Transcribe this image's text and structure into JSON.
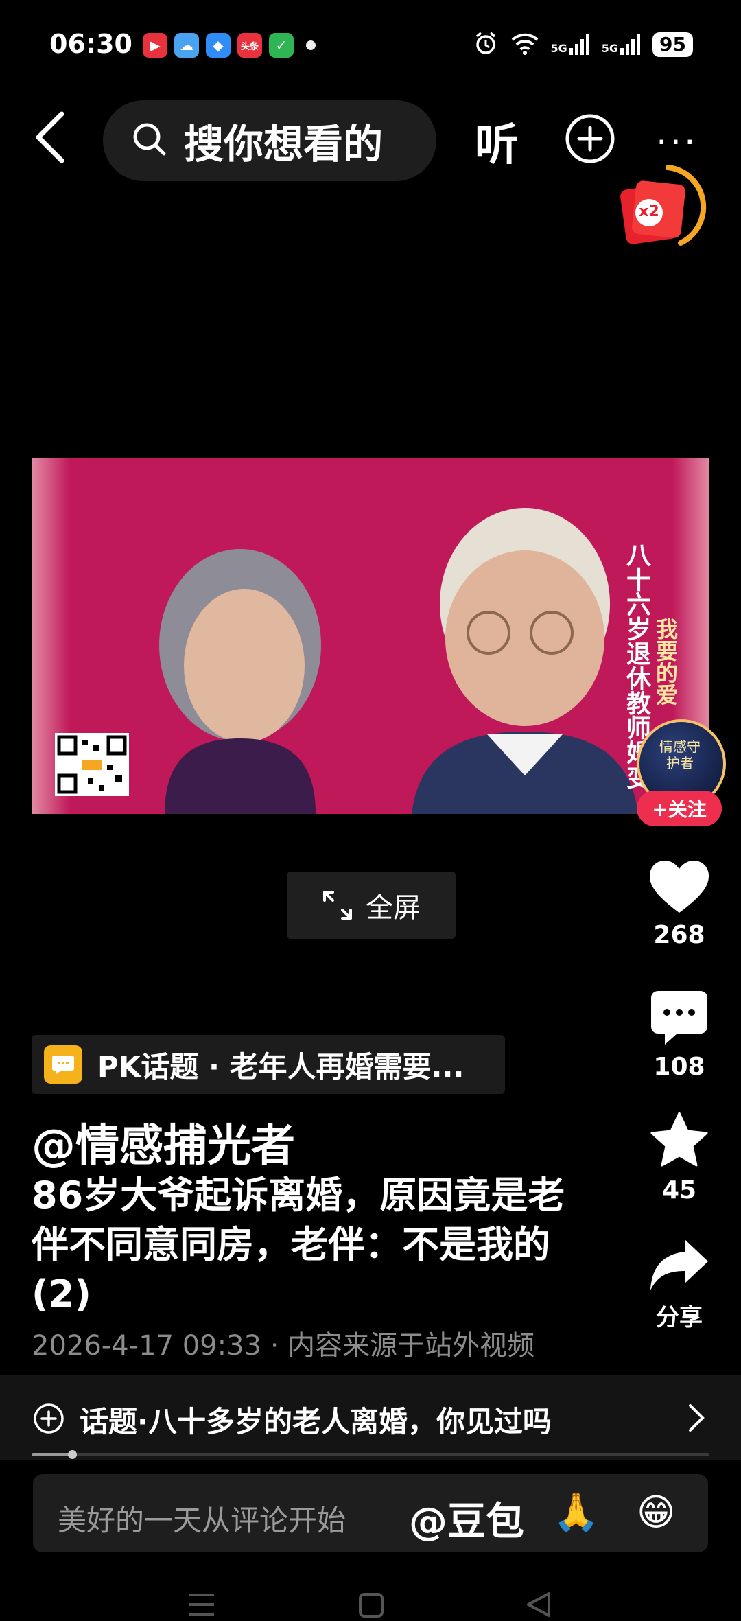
{
  "status_bar": {
    "time": "06:30",
    "app_icons": [
      {
        "name": "video-app-icon",
        "color": "#e8333f",
        "glyph": "▶"
      },
      {
        "name": "weather-app-icon",
        "color": "#4aa3f0",
        "glyph": "☁"
      },
      {
        "name": "browser-app-icon",
        "color": "#2f8df5",
        "glyph": "◆"
      },
      {
        "name": "toutiao-app-icon",
        "color": "#e8333f",
        "glyph": "头条"
      },
      {
        "name": "security-app-icon",
        "color": "#2fb553",
        "glyph": "✓"
      }
    ],
    "signal_1": "5G",
    "signal_2": "5G",
    "battery": "95"
  },
  "header": {
    "search_placeholder": "搜你想看的",
    "listen_label": "听",
    "more_label": "···"
  },
  "red_packet": {
    "multiplier": "x2"
  },
  "video": {
    "overlay_line_1": "八十六岁退休教师婚变",
    "overlay_line_2": "我要的爱",
    "accent_color": "#c0195a"
  },
  "creator": {
    "avatar_text": "情感守护者",
    "follow_label": "+关注"
  },
  "fullscreen_label": "全屏",
  "actions": {
    "likes": "268",
    "comments": "108",
    "favorites": "45",
    "share_label": "分享"
  },
  "pk_topic": "PK话题 · 老年人再婚需要...",
  "author": "@情感捕光者",
  "title": "86岁大爷起诉离婚，原因竟是老伴不同意同房，老伴：不是我的 (2)",
  "meta": "2026-4-17 09:33 · 内容来源于站外视频",
  "topic_bar": "话题·八十多岁的老人离婚，你见过吗",
  "progress_fraction": 0.06,
  "comment_bar": {
    "placeholder": "美好的一天从评论开始",
    "mention": "@豆包",
    "emoji_1": "🙏",
    "emoji_2": "😁"
  }
}
